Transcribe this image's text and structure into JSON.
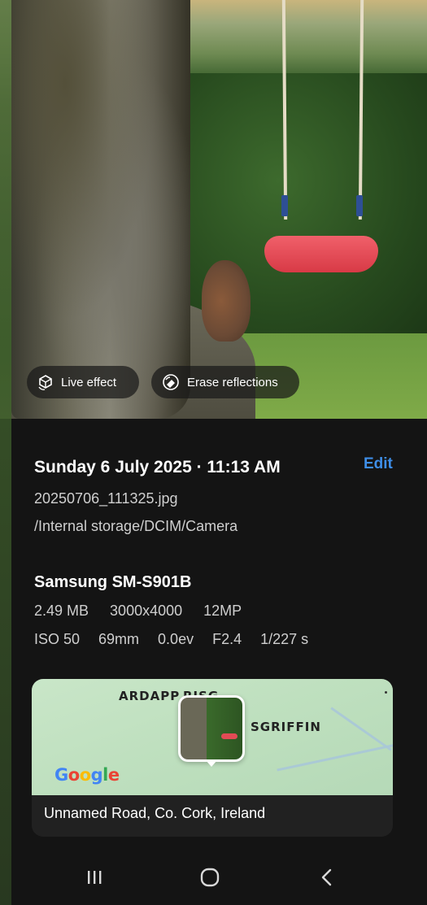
{
  "photo": {
    "chips": [
      {
        "label": "Live effect",
        "icon": "live-effect-icon"
      },
      {
        "label": "Erase reflections",
        "icon": "erase-reflections-icon"
      }
    ]
  },
  "details": {
    "datetime": "Sunday 6 July 2025 · 11:13 AM",
    "edit_label": "Edit",
    "filename": "20250706_111325.jpg",
    "path": "/Internal storage/DCIM/Camera",
    "device": "Samsung SM-S901B",
    "size": "2.49 MB",
    "resolution": "3000x4000",
    "megapixels": "12MP",
    "iso": "ISO 50",
    "focal_length": "69mm",
    "exposure": "0.0ev",
    "aperture": "F2.4",
    "shutter": "1/227 s"
  },
  "map": {
    "label_1": "ARDAPP",
    "label_1b": "RISG",
    "label_2": "SGRIFFIN",
    "provider": "Google",
    "address": "Unnamed Road, Co. Cork, Ireland"
  },
  "navbar": {
    "icons": [
      "recents-icon",
      "home-icon",
      "back-icon"
    ]
  },
  "colors": {
    "accent": "#3e8ee8",
    "background": "#141414"
  }
}
